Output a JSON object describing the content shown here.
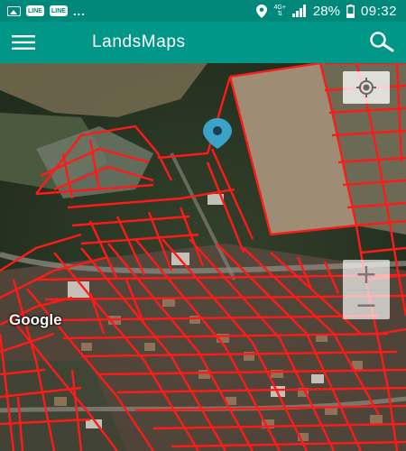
{
  "status_bar": {
    "notif_badge_1": "LINE",
    "notif_badge_2": "LINE",
    "more": "...",
    "network": "4G+",
    "battery": "28%",
    "time": "09:32"
  },
  "app_bar": {
    "title": "LandsMaps",
    "menu_icon": "hamburger-menu-icon",
    "search_icon": "search-icon"
  },
  "map": {
    "attribution": "Google",
    "zoom_in": "+",
    "zoom_out": "−",
    "locate_icon": "my-location-icon",
    "marker_icon": "location-pin-icon"
  },
  "colors": {
    "status_bar": "#00897b",
    "app_bar": "#009688",
    "parcel_outline": "#ff1a1a",
    "marker": "#3ba3c8"
  }
}
